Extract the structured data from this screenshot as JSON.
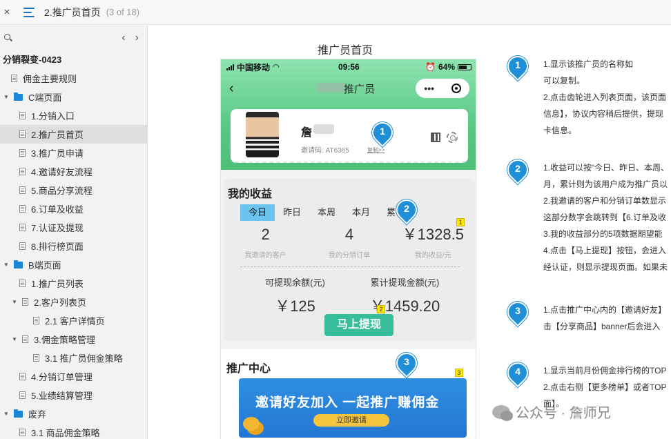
{
  "topbar": {
    "close": "×",
    "title": "2.推广员首页",
    "count": "(3 of 18)"
  },
  "sidebar": {
    "root": "分销裂变-0423",
    "items": [
      {
        "label": "佣金主要规则",
        "indent": 1,
        "kind": "page",
        "active": false
      },
      {
        "label": "C端页面",
        "indent": 0,
        "kind": "folder",
        "active": false
      },
      {
        "label": "1.分销入口",
        "indent": 2,
        "kind": "page",
        "active": false
      },
      {
        "label": "2.推广员首页",
        "indent": 2,
        "kind": "page",
        "active": true
      },
      {
        "label": "3.推广员申请",
        "indent": 2,
        "kind": "page",
        "active": false
      },
      {
        "label": "4.邀请好友流程",
        "indent": 2,
        "kind": "page",
        "active": false
      },
      {
        "label": "5.商品分享流程",
        "indent": 2,
        "kind": "page",
        "active": false
      },
      {
        "label": "6.订单及收益",
        "indent": 2,
        "kind": "page",
        "active": false
      },
      {
        "label": "7.认证及提现",
        "indent": 2,
        "kind": "page",
        "active": false
      },
      {
        "label": "8.排行榜页面",
        "indent": 2,
        "kind": "page",
        "active": false
      },
      {
        "label": "B端页面",
        "indent": 0,
        "kind": "folder",
        "active": false
      },
      {
        "label": "1.推广员列表",
        "indent": 2,
        "kind": "page",
        "active": false
      },
      {
        "label": "2.客户列表页",
        "indent": 1,
        "kind": "page-caret",
        "active": false
      },
      {
        "label": "2.1 客户详情页",
        "indent": 3,
        "kind": "page",
        "active": false
      },
      {
        "label": "3.佣金策略管理",
        "indent": 1,
        "kind": "page-caret",
        "active": false
      },
      {
        "label": "3.1 推广员佣金策略",
        "indent": 3,
        "kind": "page",
        "active": false
      },
      {
        "label": "4.分销订单管理",
        "indent": 2,
        "kind": "page",
        "active": false
      },
      {
        "label": "5.业绩结算管理",
        "indent": 2,
        "kind": "page",
        "active": false
      },
      {
        "label": "废弃",
        "indent": 0,
        "kind": "folder",
        "active": false
      },
      {
        "label": "3.1 商品佣金策略",
        "indent": 2,
        "kind": "page",
        "active": false
      }
    ]
  },
  "canvas": {
    "title": "推广员首页"
  },
  "phone": {
    "carrier": "中国移动",
    "time": "09:56",
    "battery": "64%",
    "nav_title": "推广员",
    "capsule_dots": "•••",
    "profile": {
      "name": "詹",
      "invite_code": "邀请码:  AT6365",
      "copy": "复制>>"
    },
    "earnings": {
      "title": "我的收益",
      "tabs": [
        "今日",
        "昨日",
        "本周",
        "本月",
        "累计"
      ],
      "active_tab": "今日",
      "stats": [
        {
          "value": "2",
          "label": "我邀请的客户"
        },
        {
          "value": "4",
          "label": "我的分销订单"
        },
        {
          "value": "￥1328.5",
          "label": "我的收益/元"
        }
      ],
      "balances": [
        {
          "label": "可提现余额(元)",
          "value": "￥125"
        },
        {
          "label": "累计提现金额(元)",
          "value": "￥1459.20"
        }
      ],
      "withdraw": "马上提现"
    },
    "promo": {
      "title": "推广中心",
      "banner_text": "邀请好友加入   一起推广赚佣金",
      "banner_button": "立即邀请"
    }
  },
  "markers": [
    "1",
    "2",
    "3",
    "4"
  ],
  "flags": [
    "1",
    "2",
    "3"
  ],
  "notes": [
    [
      "1.显示该推广员的名称如",
      "可以复制。",
      "2.点击齿轮进入列表页面，该页面",
      "信息】，协议内容稍后提供，提现",
      "卡信息。"
    ],
    [
      "1.收益可以按“今日、昨日、本周、",
      "月，累计则为该用户成为推广员以",
      "2.我邀请的客户和分销订单数显示",
      "这部分数字会跳转到【6.订单及收",
      "3.我的收益部分的5项数据期望能",
      "4.点击【马上提现】按钮，会进入",
      "经认证，则显示提现页面。如果未"
    ],
    [
      "1.点击推广中心内的【邀请好友】",
      "击【分享商品】banner后会进入"
    ],
    [
      "1.显示当前月份佣金排行榜的TOP",
      "2.点击右侧【更多榜单】或者TOP",
      "面】。"
    ]
  ],
  "watermark": "公众号 · 詹师兄",
  "colors": {
    "accent": "#1f8fd8",
    "tab_active": "#6bc3ef",
    "withdraw": "#36be9a",
    "banner": "#2477d3"
  }
}
